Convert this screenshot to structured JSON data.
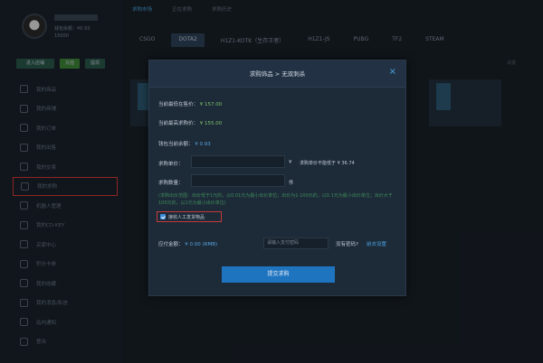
{
  "profile": {
    "balance_text": "钱包余额：¥0.93",
    "points_text": "15000"
  },
  "side_actions": [
    "进入店铺",
    "充值",
    "提现"
  ],
  "menu": [
    "我的商品",
    "我的商铺",
    "我的订单",
    "我的出售",
    "我的交易",
    "我的求购",
    "机器人管理",
    "我的CD-KEY",
    "买家中心",
    "积分卡券",
    "我的收藏",
    "我的消息/私信",
    "站内通知",
    "登出"
  ],
  "top_tabs": [
    "求购市场",
    "正在求购",
    "求购历史"
  ],
  "game_tabs": [
    "CSGO",
    "DOTA2",
    "H1Z1-KOTK（生存王者）",
    "H1Z1-JS",
    "PUBG",
    "TF2",
    "STEAM"
  ],
  "bg_search": "关键",
  "modal": {
    "title": "求购饰品 > 无双刺杀",
    "close_icon": "×",
    "lowest_sell_label": "当前最低在售价：",
    "lowest_sell_value": "¥ 157.00",
    "highest_buy_label": "当前最高求购价：",
    "highest_buy_value": "¥ 155.00",
    "wallet_label": "钱包当前余额：",
    "wallet_value": "¥ 0.93",
    "unit_price_label": "求购单价：",
    "currency": "¥",
    "unit_price_hint": "求购单价不能低于 ¥ 36.74",
    "quantity_label": "求购数量：",
    "quantity_unit": "件",
    "rule_text": "(求购出价范围：出价低于1元的，以0.01元为最小出价单位；出价为1-100元的，以0.1元为最小出价单位；出价大于100元的，以1元为最小出价单位)",
    "checkbox_label": "接收人工发货物品",
    "total_label": "应付金额：",
    "total_value": "¥ 0.00",
    "total_currency": "(RMB)",
    "password_placeholder": "请输入支付密码",
    "no_password": "没有密码?",
    "set_password": "前去设置",
    "submit": "提交求购"
  },
  "colors": {
    "accent_blue": "#1f74c0",
    "price_green": "#7ec36b",
    "highlight_red": "#c43a3a"
  }
}
